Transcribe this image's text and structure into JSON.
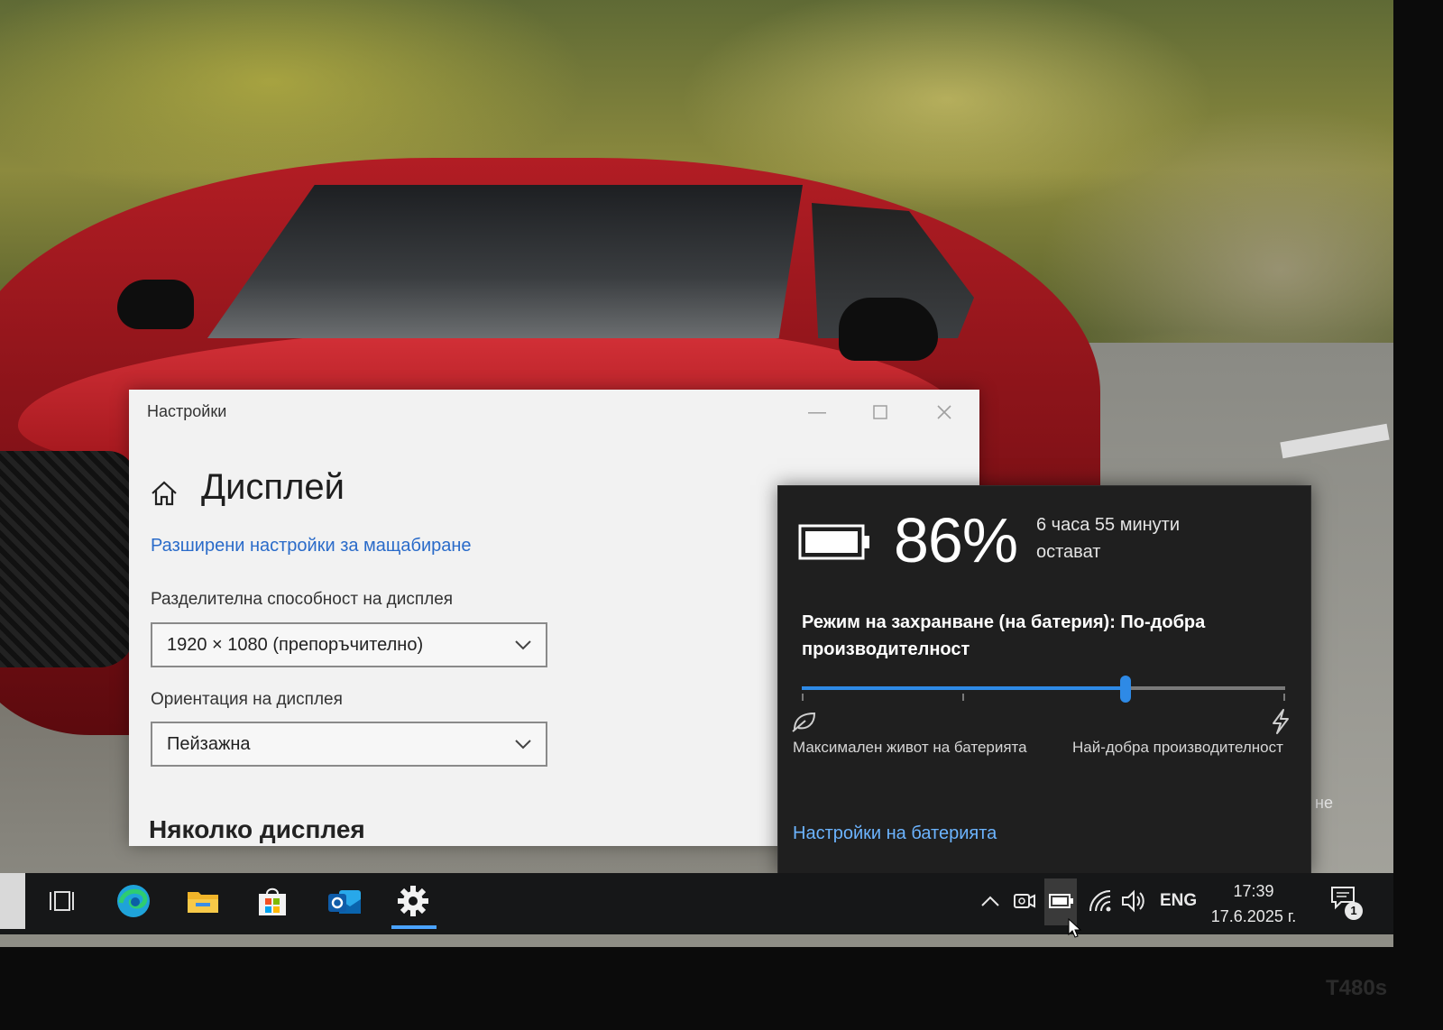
{
  "settings_window": {
    "title": "Настройки",
    "page_title": "Дисплей",
    "scaling_link": "Разширени настройки за мащабиране",
    "resolution_label": "Разделителна способност на дисплея",
    "resolution_value": "1920 × 1080 (препоръчително)",
    "orientation_label": "Ориентация на дисплея",
    "orientation_value": "Пейзажна",
    "multiple_displays_heading": "Няколко дисплея"
  },
  "battery_flyout": {
    "percent": "86%",
    "percent_value": 86,
    "remaining": "6 часа 55 минути остават",
    "power_mode": "Режим на захранване (на батерия): По-добра производителност",
    "slider_position": 0.67,
    "label_min": "Максимален живот на батерията",
    "label_max": "Най-добра производителност",
    "settings_link": "Настройки на батерията",
    "accent_color": "#2e8ae6"
  },
  "taskbar": {
    "apps": [
      "task-view-icon",
      "edge-icon",
      "file-explorer-icon",
      "store-icon",
      "outlook-icon",
      "settings-gear-icon"
    ],
    "active_app": "settings-gear-icon",
    "tray": {
      "language": "ENG",
      "time": "17:39",
      "date": "17.6.2025 г.",
      "notification_count": "1"
    }
  },
  "partial_text_right_edge": "не",
  "bezel_model": "T480s"
}
